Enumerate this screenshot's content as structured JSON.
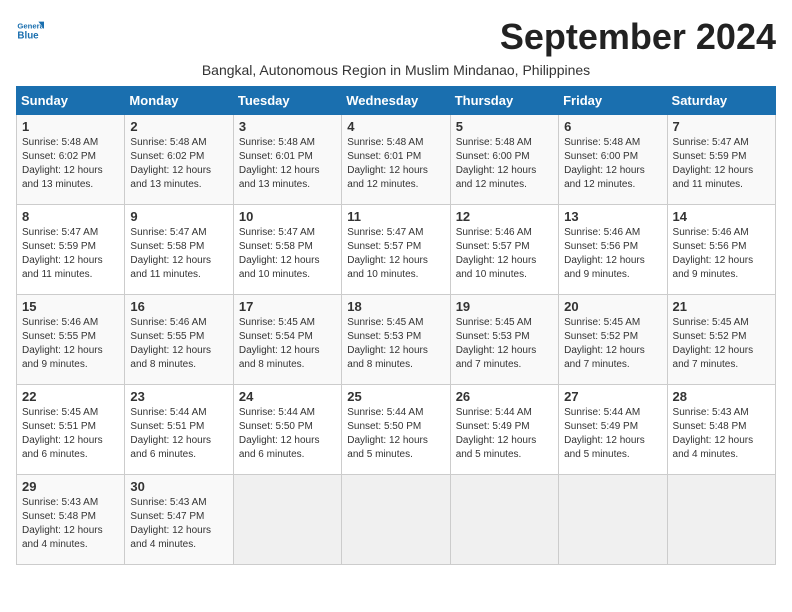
{
  "header": {
    "logo_general": "General",
    "logo_blue": "Blue",
    "month_title": "September 2024",
    "subtitle": "Bangkal, Autonomous Region in Muslim Mindanao, Philippines"
  },
  "weekdays": [
    "Sunday",
    "Monday",
    "Tuesday",
    "Wednesday",
    "Thursday",
    "Friday",
    "Saturday"
  ],
  "weeks": [
    [
      {
        "day": "1",
        "sunrise": "5:48 AM",
        "sunset": "6:02 PM",
        "daylight": "12 hours and 13 minutes."
      },
      {
        "day": "2",
        "sunrise": "5:48 AM",
        "sunset": "6:02 PM",
        "daylight": "12 hours and 13 minutes."
      },
      {
        "day": "3",
        "sunrise": "5:48 AM",
        "sunset": "6:01 PM",
        "daylight": "12 hours and 13 minutes."
      },
      {
        "day": "4",
        "sunrise": "5:48 AM",
        "sunset": "6:01 PM",
        "daylight": "12 hours and 12 minutes."
      },
      {
        "day": "5",
        "sunrise": "5:48 AM",
        "sunset": "6:00 PM",
        "daylight": "12 hours and 12 minutes."
      },
      {
        "day": "6",
        "sunrise": "5:48 AM",
        "sunset": "6:00 PM",
        "daylight": "12 hours and 12 minutes."
      },
      {
        "day": "7",
        "sunrise": "5:47 AM",
        "sunset": "5:59 PM",
        "daylight": "12 hours and 11 minutes."
      }
    ],
    [
      {
        "day": "8",
        "sunrise": "5:47 AM",
        "sunset": "5:59 PM",
        "daylight": "12 hours and 11 minutes."
      },
      {
        "day": "9",
        "sunrise": "5:47 AM",
        "sunset": "5:58 PM",
        "daylight": "12 hours and 11 minutes."
      },
      {
        "day": "10",
        "sunrise": "5:47 AM",
        "sunset": "5:58 PM",
        "daylight": "12 hours and 10 minutes."
      },
      {
        "day": "11",
        "sunrise": "5:47 AM",
        "sunset": "5:57 PM",
        "daylight": "12 hours and 10 minutes."
      },
      {
        "day": "12",
        "sunrise": "5:46 AM",
        "sunset": "5:57 PM",
        "daylight": "12 hours and 10 minutes."
      },
      {
        "day": "13",
        "sunrise": "5:46 AM",
        "sunset": "5:56 PM",
        "daylight": "12 hours and 9 minutes."
      },
      {
        "day": "14",
        "sunrise": "5:46 AM",
        "sunset": "5:56 PM",
        "daylight": "12 hours and 9 minutes."
      }
    ],
    [
      {
        "day": "15",
        "sunrise": "5:46 AM",
        "sunset": "5:55 PM",
        "daylight": "12 hours and 9 minutes."
      },
      {
        "day": "16",
        "sunrise": "5:46 AM",
        "sunset": "5:55 PM",
        "daylight": "12 hours and 8 minutes."
      },
      {
        "day": "17",
        "sunrise": "5:45 AM",
        "sunset": "5:54 PM",
        "daylight": "12 hours and 8 minutes."
      },
      {
        "day": "18",
        "sunrise": "5:45 AM",
        "sunset": "5:53 PM",
        "daylight": "12 hours and 8 minutes."
      },
      {
        "day": "19",
        "sunrise": "5:45 AM",
        "sunset": "5:53 PM",
        "daylight": "12 hours and 7 minutes."
      },
      {
        "day": "20",
        "sunrise": "5:45 AM",
        "sunset": "5:52 PM",
        "daylight": "12 hours and 7 minutes."
      },
      {
        "day": "21",
        "sunrise": "5:45 AM",
        "sunset": "5:52 PM",
        "daylight": "12 hours and 7 minutes."
      }
    ],
    [
      {
        "day": "22",
        "sunrise": "5:45 AM",
        "sunset": "5:51 PM",
        "daylight": "12 hours and 6 minutes."
      },
      {
        "day": "23",
        "sunrise": "5:44 AM",
        "sunset": "5:51 PM",
        "daylight": "12 hours and 6 minutes."
      },
      {
        "day": "24",
        "sunrise": "5:44 AM",
        "sunset": "5:50 PM",
        "daylight": "12 hours and 6 minutes."
      },
      {
        "day": "25",
        "sunrise": "5:44 AM",
        "sunset": "5:50 PM",
        "daylight": "12 hours and 5 minutes."
      },
      {
        "day": "26",
        "sunrise": "5:44 AM",
        "sunset": "5:49 PM",
        "daylight": "12 hours and 5 minutes."
      },
      {
        "day": "27",
        "sunrise": "5:44 AM",
        "sunset": "5:49 PM",
        "daylight": "12 hours and 5 minutes."
      },
      {
        "day": "28",
        "sunrise": "5:43 AM",
        "sunset": "5:48 PM",
        "daylight": "12 hours and 4 minutes."
      }
    ],
    [
      {
        "day": "29",
        "sunrise": "5:43 AM",
        "sunset": "5:48 PM",
        "daylight": "12 hours and 4 minutes."
      },
      {
        "day": "30",
        "sunrise": "5:43 AM",
        "sunset": "5:47 PM",
        "daylight": "12 hours and 4 minutes."
      },
      null,
      null,
      null,
      null,
      null
    ]
  ]
}
